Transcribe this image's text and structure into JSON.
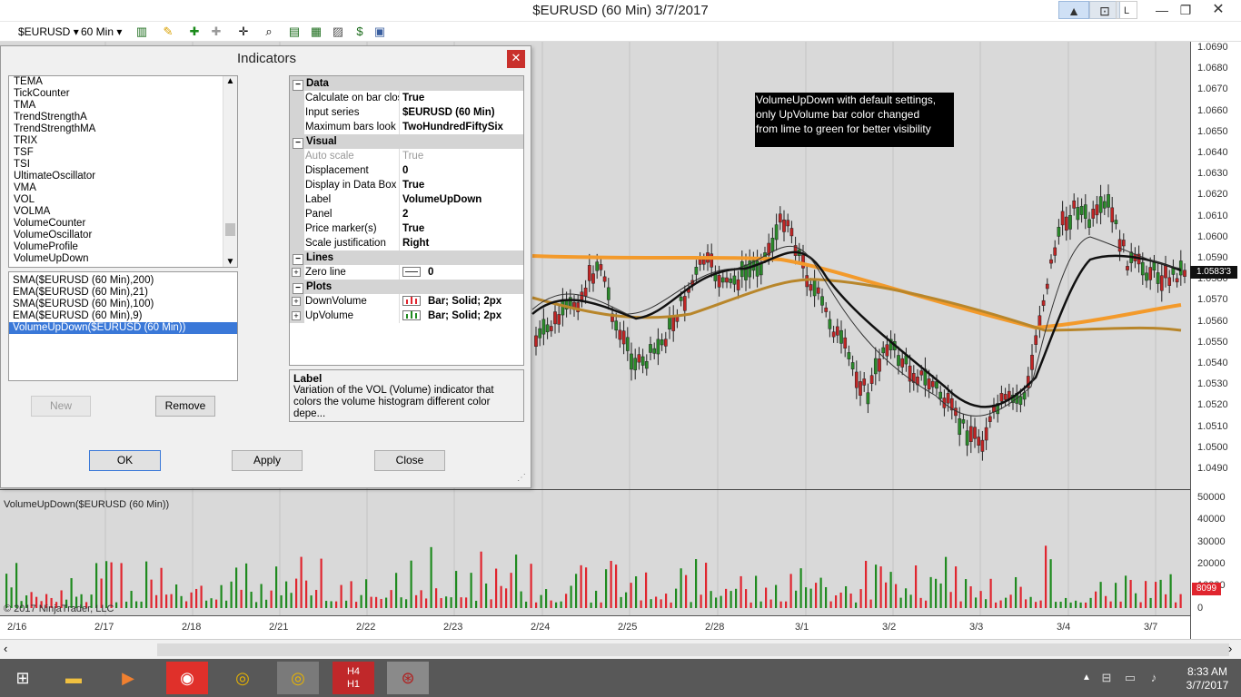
{
  "window": {
    "title": "$EURUSD (60 Min)  3/7/2017",
    "controls": [
      "L"
    ]
  },
  "toolbar": {
    "instrument": "$EURUSD",
    "interval": "60 Min"
  },
  "dialog": {
    "title": "Indicators",
    "indicator_list": [
      "TEMA",
      "TickCounter",
      "TMA",
      "TrendStrengthA",
      "TrendStrengthMA",
      "TRIX",
      "TSF",
      "TSI",
      "UltimateOscillator",
      "VMA",
      "VOL",
      "VOLMA",
      "VolumeCounter",
      "VolumeOscillator",
      "VolumeProfile",
      "VolumeUpDown"
    ],
    "applied": [
      "SMA($EURUSD (60 Min),200)",
      "EMA($EURUSD (60 Min),21)",
      "SMA($EURUSD (60 Min),100)",
      "EMA($EURUSD (60 Min),9)",
      "VolumeUpDown($EURUSD (60 Min))"
    ],
    "buttons": {
      "new": "New",
      "remove": "Remove",
      "ok": "OK",
      "apply": "Apply",
      "close": "Close"
    },
    "properties": [
      {
        "type": "cat",
        "label": "Data"
      },
      {
        "type": "prop",
        "name": "Calculate on bar clos",
        "value": "True"
      },
      {
        "type": "prop",
        "name": "Input series",
        "value": "$EURUSD (60 Min)"
      },
      {
        "type": "prop",
        "name": "Maximum bars look b",
        "value": "TwoHundredFiftySix"
      },
      {
        "type": "cat",
        "label": "Visual"
      },
      {
        "type": "prop",
        "name": "Auto scale",
        "value": "True",
        "disabled": true
      },
      {
        "type": "prop",
        "name": "Displacement",
        "value": "0"
      },
      {
        "type": "prop",
        "name": "Display in Data Box",
        "value": "True"
      },
      {
        "type": "prop",
        "name": "Label",
        "value": "VolumeUpDown"
      },
      {
        "type": "prop",
        "name": "Panel",
        "value": "2"
      },
      {
        "type": "prop",
        "name": "Price marker(s)",
        "value": "True"
      },
      {
        "type": "prop",
        "name": "Scale justification",
        "value": "Right"
      },
      {
        "type": "cat",
        "label": "Lines"
      },
      {
        "type": "prop",
        "name": "Zero line",
        "value": "0",
        "expand": true,
        "swatch": "line"
      },
      {
        "type": "cat",
        "label": "Plots"
      },
      {
        "type": "prop",
        "name": "DownVolume",
        "value": "Bar; Solid; 2px",
        "expand": true,
        "swatch": "red"
      },
      {
        "type": "prop",
        "name": "UpVolume",
        "value": "Bar; Solid; 2px",
        "expand": true,
        "swatch": "green"
      }
    ],
    "description": {
      "heading": "Label",
      "text": "Variation of the VOL (Volume) indicator that colors the volume histogram different color depe..."
    }
  },
  "chart": {
    "annotation_lines": [
      "VolumeUpDown with default settings,",
      "only UpVolume bar color changed",
      "from lime to green for better visibility"
    ],
    "price_ticks": [
      "1.0690",
      "1.0680",
      "1.0670",
      "1.0660",
      "1.0650",
      "1.0640",
      "1.0630",
      "1.0620",
      "1.0610",
      "1.0600",
      "1.0590",
      "1.0580",
      "1.0570",
      "1.0560",
      "1.0550",
      "1.0540",
      "1.0530",
      "1.0520",
      "1.0510",
      "1.0500",
      "1.0490"
    ],
    "last_price": "1.0583'3",
    "volume_ticks": [
      "50000",
      "40000",
      "30000",
      "20000",
      "10000",
      "0"
    ],
    "last_volume": "8099",
    "volume_panel_label": "VolumeUpDown($EURUSD (60 Min))",
    "copyright": "© 2017 NinjaTrader, LLC",
    "dates": [
      "2/16",
      "2/17",
      "2/18",
      "2/21",
      "2/22",
      "2/23",
      "2/24",
      "2/25",
      "2/28",
      "3/1",
      "3/2",
      "3/3",
      "3/4",
      "3/7"
    ],
    "colors": {
      "up": "#1f8a1f",
      "down": "#e0252e",
      "sma200": "#f39a2b",
      "sma100": "#b8862b",
      "ema21": "#111111",
      "ema9": "#333333"
    }
  },
  "taskbar": {
    "time": "8:33 AM",
    "date": "3/7/2017"
  }
}
